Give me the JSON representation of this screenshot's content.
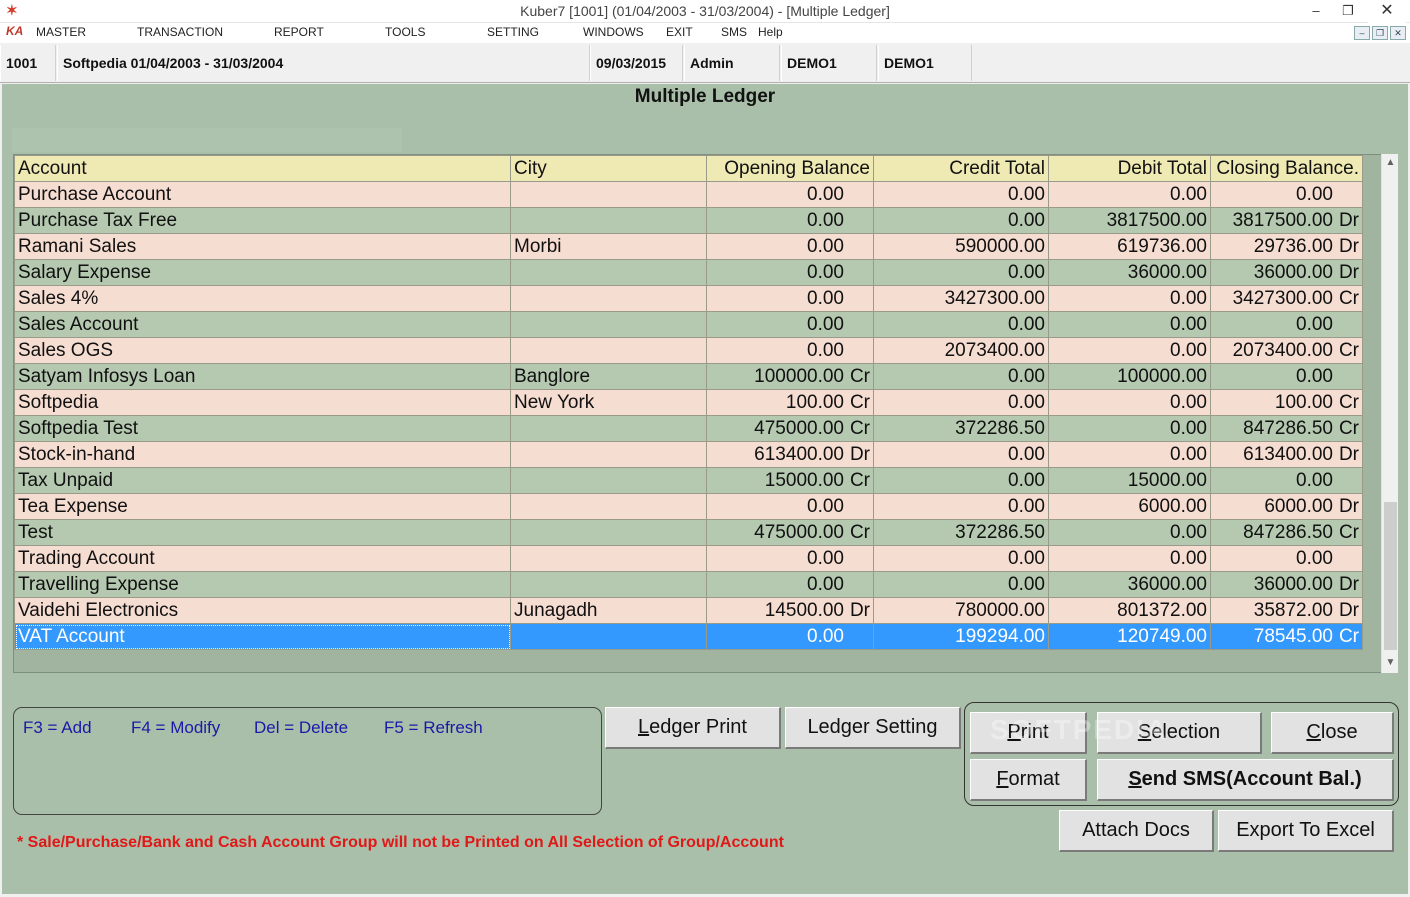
{
  "window": {
    "title": "Kuber7 [1001] (01/04/2003 - 31/03/2004) - [Multiple Ledger]",
    "app_icon": "kuber-app-icon",
    "controls": {
      "minimize": "–",
      "restore": "❐",
      "close": "✕"
    }
  },
  "menu": {
    "logo": "KA",
    "items": [
      "MASTER",
      "TRANSACTION",
      "REPORT",
      "TOOLS",
      "SETTING",
      "WINDOWS",
      "EXIT",
      "SMS",
      "Help"
    ],
    "mdi_controls": {
      "minimize": "–",
      "restore": "❐",
      "close": "✕"
    }
  },
  "info": {
    "company_code": "1001",
    "company": "Softpedia  01/04/2003 - 31/03/2004",
    "date": "09/03/2015",
    "user": "Admin",
    "db1": "DEMO1",
    "db2": "DEMO1"
  },
  "page_title": "Multiple Ledger",
  "grid": {
    "columns": [
      "Account",
      "City",
      "Opening Balance",
      "Credit Total",
      "Debit Total",
      "Closing Balance."
    ],
    "rows": [
      {
        "account": "Purchase Account",
        "city": "",
        "opening": "0.00",
        "opening_suffix": "",
        "credit": "0.00",
        "debit": "0.00",
        "closing": "0.00",
        "closing_suffix": ""
      },
      {
        "account": "Purchase Tax Free",
        "city": "",
        "opening": "0.00",
        "opening_suffix": "",
        "credit": "0.00",
        "debit": "3817500.00",
        "closing": "3817500.00",
        "closing_suffix": "Dr"
      },
      {
        "account": "Ramani Sales",
        "city": "Morbi",
        "opening": "0.00",
        "opening_suffix": "",
        "credit": "590000.00",
        "debit": "619736.00",
        "closing": "29736.00",
        "closing_suffix": "Dr"
      },
      {
        "account": "Salary Expense",
        "city": "",
        "opening": "0.00",
        "opening_suffix": "",
        "credit": "0.00",
        "debit": "36000.00",
        "closing": "36000.00",
        "closing_suffix": "Dr"
      },
      {
        "account": "Sales 4%",
        "city": "",
        "opening": "0.00",
        "opening_suffix": "",
        "credit": "3427300.00",
        "debit": "0.00",
        "closing": "3427300.00",
        "closing_suffix": "Cr"
      },
      {
        "account": "Sales Account",
        "city": "",
        "opening": "0.00",
        "opening_suffix": "",
        "credit": "0.00",
        "debit": "0.00",
        "closing": "0.00",
        "closing_suffix": ""
      },
      {
        "account": "Sales OGS",
        "city": "",
        "opening": "0.00",
        "opening_suffix": "",
        "credit": "2073400.00",
        "debit": "0.00",
        "closing": "2073400.00",
        "closing_suffix": "Cr"
      },
      {
        "account": "Satyam Infosys Loan",
        "city": "Banglore",
        "opening": "100000.00",
        "opening_suffix": "Cr",
        "credit": "0.00",
        "debit": "100000.00",
        "closing": "0.00",
        "closing_suffix": ""
      },
      {
        "account": "Softpedia",
        "city": "New York",
        "opening": "100.00",
        "opening_suffix": "Cr",
        "credit": "0.00",
        "debit": "0.00",
        "closing": "100.00",
        "closing_suffix": "Cr"
      },
      {
        "account": "Softpedia Test",
        "city": "",
        "opening": "475000.00",
        "opening_suffix": "Cr",
        "credit": "372286.50",
        "debit": "0.00",
        "closing": "847286.50",
        "closing_suffix": "Cr"
      },
      {
        "account": "Stock-in-hand",
        "city": "",
        "opening": "613400.00",
        "opening_suffix": "Dr",
        "credit": "0.00",
        "debit": "0.00",
        "closing": "613400.00",
        "closing_suffix": "Dr"
      },
      {
        "account": "Tax Unpaid",
        "city": "",
        "opening": "15000.00",
        "opening_suffix": "Cr",
        "credit": "0.00",
        "debit": "15000.00",
        "closing": "0.00",
        "closing_suffix": ""
      },
      {
        "account": "Tea Expense",
        "city": "",
        "opening": "0.00",
        "opening_suffix": "",
        "credit": "0.00",
        "debit": "6000.00",
        "closing": "6000.00",
        "closing_suffix": "Dr"
      },
      {
        "account": "Test",
        "city": "",
        "opening": "475000.00",
        "opening_suffix": "Cr",
        "credit": "372286.50",
        "debit": "0.00",
        "closing": "847286.50",
        "closing_suffix": "Cr"
      },
      {
        "account": "Trading Account",
        "city": "",
        "opening": "0.00",
        "opening_suffix": "",
        "credit": "0.00",
        "debit": "0.00",
        "closing": "0.00",
        "closing_suffix": ""
      },
      {
        "account": "Travelling Expense",
        "city": "",
        "opening": "0.00",
        "opening_suffix": "",
        "credit": "0.00",
        "debit": "36000.00",
        "closing": "36000.00",
        "closing_suffix": "Dr"
      },
      {
        "account": "Vaidehi Electronics",
        "city": "Junagadh",
        "opening": "14500.00",
        "opening_suffix": "Dr",
        "credit": "780000.00",
        "debit": "801372.00",
        "closing": "35872.00",
        "closing_suffix": "Dr"
      },
      {
        "account": "VAT Account",
        "city": "",
        "opening": "0.00",
        "opening_suffix": "",
        "credit": "199294.00",
        "debit": "120749.00",
        "closing": "78545.00",
        "closing_suffix": "Cr",
        "selected": true
      }
    ],
    "scroll_up": "▲",
    "scroll_down": "▼"
  },
  "shortcuts": {
    "add": "F3 =  Add",
    "modify": "F4 = Modify",
    "delete": "Del =  Delete",
    "refresh": "F5 =  Refresh"
  },
  "buttons": {
    "ledger_print": "Ledger Print",
    "ledger_setting": "Ledger Setting",
    "print": "Print",
    "selection": "Selection",
    "close": "Close",
    "format": "Format",
    "send_sms": "Send SMS(Account Bal.)",
    "attach_docs": "Attach Docs",
    "export_excel": "Export To Excel"
  },
  "note": "*  Sale/Purchase/Bank and Cash Account Group will not be Printed on All Selection of Group/Account",
  "watermark": "SOFTPEDIA",
  "colors": {
    "panel_bg": "#a9bfa9",
    "row_odd": "#f6ddd2",
    "row_even": "#b5c8b0",
    "header_bg": "#efe9b3",
    "selected_row": "#3399ff",
    "shortcut_text": "#1a1aa8",
    "note_text": "#e01818"
  }
}
